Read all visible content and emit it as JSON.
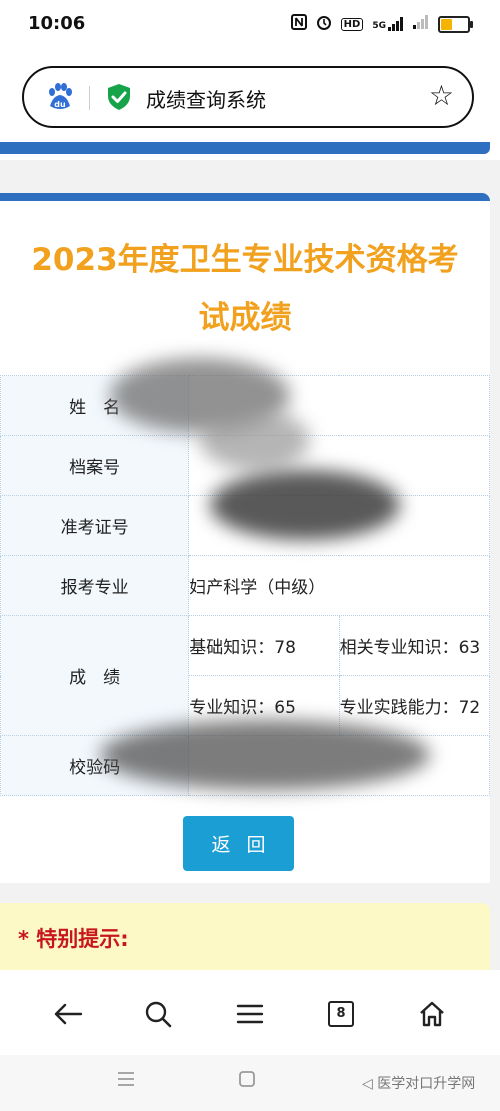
{
  "status_bar": {
    "time": "10:06",
    "icons": [
      "nfc-icon",
      "alarm-icon",
      "hd-icon",
      "signal-5g-icon",
      "signal-icon",
      "battery-icon"
    ],
    "hd_label": "HD",
    "net_label": "5G"
  },
  "browser": {
    "address_title": "成绩查询系统",
    "logo_text": "du"
  },
  "card": {
    "title_line1": "2023年度卫生专业技术资格考",
    "title_line2": "试成绩",
    "rows": {
      "name_label": "姓　名",
      "archive_label": "档案号",
      "ticket_label": "准考证号",
      "major_label": "报考专业",
      "major_value": "妇产科学（中级）",
      "score_label": "成　绩",
      "basic_knowledge": "基础知识：78",
      "related_knowledge": "相关专业知识：63",
      "professional_knowledge": "专业知识：65",
      "practical_ability": "专业实践能力：72",
      "check_label": "校验码"
    },
    "back_button": "返回"
  },
  "notice": {
    "text": "* 特别提示:"
  },
  "toolbar": {
    "tab_count": "8"
  },
  "watermark": "◁ 医学对口升学网",
  "colors": {
    "accent_blue": "#2f6fc0",
    "title_orange": "#f1a11d",
    "button_blue": "#1b9ed4",
    "notice_red": "#c7171c",
    "notice_bg": "#fdf9c6"
  }
}
